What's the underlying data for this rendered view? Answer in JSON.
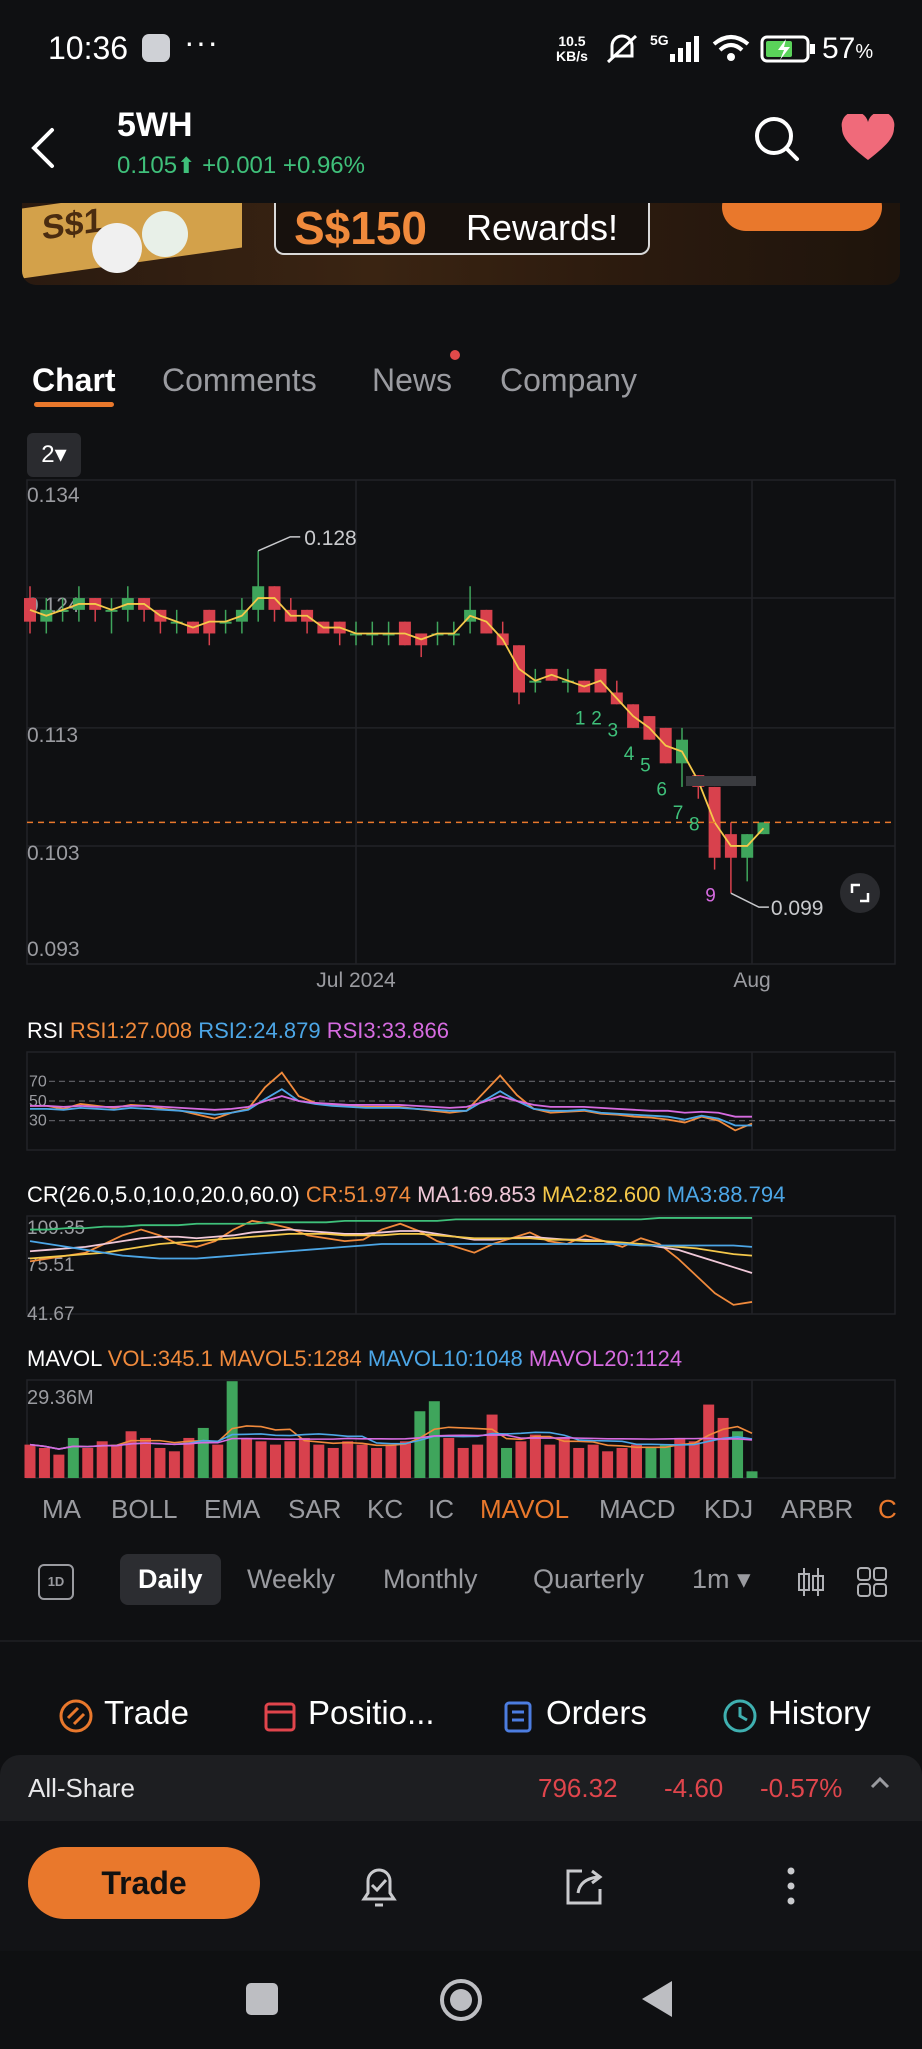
{
  "status_bar": {
    "time": "10:36",
    "menu_dots": "···",
    "net_speed": "10.5",
    "net_unit": "KB/s",
    "signal": "5G",
    "battery": "57",
    "battery_unit": "%"
  },
  "header": {
    "symbol": "5WH",
    "price": "0.105",
    "change": "+0.001",
    "change_pct": "+0.96%"
  },
  "banner": {
    "amount": "S$150",
    "text": "Rewards!",
    "card_text": "S$1"
  },
  "tabs": [
    {
      "label": "Chart",
      "active": true
    },
    {
      "label": "Comments",
      "active": false
    },
    {
      "label": "News",
      "active": false
    },
    {
      "label": "Company",
      "active": false
    }
  ],
  "chart_period_selector": "2▾",
  "chart_data": [
    {
      "type": "candlestick",
      "title": "",
      "y_ticks": [
        "0.134",
        "0.124",
        "0.113",
        "0.103",
        "0.093"
      ],
      "ylim": [
        0.093,
        0.134
      ],
      "x_ticks": [
        "Jul 2024",
        "Aug"
      ],
      "high_label": "0.128",
      "low_label": "0.099",
      "last_price_line": 0.105,
      "sequence_labels": [
        "1",
        "2",
        "3",
        "4",
        "5",
        "6",
        "7",
        "8",
        "9"
      ],
      "candles": [
        {
          "o": 0.124,
          "c": 0.122,
          "h": 0.125,
          "l": 0.121
        },
        {
          "o": 0.122,
          "c": 0.123,
          "h": 0.124,
          "l": 0.121
        },
        {
          "o": 0.123,
          "c": 0.123,
          "h": 0.124,
          "l": 0.122
        },
        {
          "o": 0.123,
          "c": 0.124,
          "h": 0.125,
          "l": 0.122
        },
        {
          "o": 0.124,
          "c": 0.123,
          "h": 0.124,
          "l": 0.122
        },
        {
          "o": 0.123,
          "c": 0.123,
          "h": 0.124,
          "l": 0.121
        },
        {
          "o": 0.123,
          "c": 0.124,
          "h": 0.125,
          "l": 0.122
        },
        {
          "o": 0.124,
          "c": 0.123,
          "h": 0.124,
          "l": 0.122
        },
        {
          "o": 0.123,
          "c": 0.122,
          "h": 0.123,
          "l": 0.121
        },
        {
          "o": 0.122,
          "c": 0.122,
          "h": 0.123,
          "l": 0.121
        },
        {
          "o": 0.122,
          "c": 0.121,
          "h": 0.122,
          "l": 0.121
        },
        {
          "o": 0.123,
          "c": 0.121,
          "h": 0.123,
          "l": 0.12
        },
        {
          "o": 0.122,
          "c": 0.122,
          "h": 0.123,
          "l": 0.121
        },
        {
          "o": 0.122,
          "c": 0.123,
          "h": 0.124,
          "l": 0.121
        },
        {
          "o": 0.123,
          "c": 0.125,
          "h": 0.128,
          "l": 0.122
        },
        {
          "o": 0.125,
          "c": 0.123,
          "h": 0.125,
          "l": 0.122
        },
        {
          "o": 0.123,
          "c": 0.122,
          "h": 0.124,
          "l": 0.122
        },
        {
          "o": 0.123,
          "c": 0.122,
          "h": 0.123,
          "l": 0.121
        },
        {
          "o": 0.122,
          "c": 0.121,
          "h": 0.122,
          "l": 0.121
        },
        {
          "o": 0.122,
          "c": 0.121,
          "h": 0.122,
          "l": 0.12
        },
        {
          "o": 0.121,
          "c": 0.121,
          "h": 0.122,
          "l": 0.12
        },
        {
          "o": 0.121,
          "c": 0.121,
          "h": 0.122,
          "l": 0.12
        },
        {
          "o": 0.121,
          "c": 0.121,
          "h": 0.122,
          "l": 0.12
        },
        {
          "o": 0.122,
          "c": 0.12,
          "h": 0.122,
          "l": 0.12
        },
        {
          "o": 0.121,
          "c": 0.12,
          "h": 0.121,
          "l": 0.119
        },
        {
          "o": 0.121,
          "c": 0.121,
          "h": 0.122,
          "l": 0.12
        },
        {
          "o": 0.121,
          "c": 0.121,
          "h": 0.122,
          "l": 0.12
        },
        {
          "o": 0.122,
          "c": 0.123,
          "h": 0.125,
          "l": 0.121
        },
        {
          "o": 0.123,
          "c": 0.121,
          "h": 0.123,
          "l": 0.121
        },
        {
          "o": 0.121,
          "c": 0.12,
          "h": 0.122,
          "l": 0.12
        },
        {
          "o": 0.12,
          "c": 0.116,
          "h": 0.12,
          "l": 0.115
        },
        {
          "o": 0.117,
          "c": 0.117,
          "h": 0.118,
          "l": 0.116
        },
        {
          "o": 0.118,
          "c": 0.117,
          "h": 0.118,
          "l": 0.117
        },
        {
          "o": 0.117,
          "c": 0.117,
          "h": 0.118,
          "l": 0.116
        },
        {
          "o": 0.117,
          "c": 0.116,
          "h": 0.117,
          "l": 0.116
        },
        {
          "o": 0.118,
          "c": 0.116,
          "h": 0.118,
          "l": 0.116
        },
        {
          "o": 0.116,
          "c": 0.115,
          "h": 0.117,
          "l": 0.115
        },
        {
          "o": 0.115,
          "c": 0.113,
          "h": 0.115,
          "l": 0.113
        },
        {
          "o": 0.114,
          "c": 0.112,
          "h": 0.114,
          "l": 0.112
        },
        {
          "o": 0.113,
          "c": 0.11,
          "h": 0.113,
          "l": 0.11
        },
        {
          "o": 0.11,
          "c": 0.112,
          "h": 0.113,
          "l": 0.108
        },
        {
          "o": 0.109,
          "c": 0.108,
          "h": 0.109,
          "l": 0.107
        },
        {
          "o": 0.108,
          "c": 0.102,
          "h": 0.108,
          "l": 0.101
        },
        {
          "o": 0.104,
          "c": 0.102,
          "h": 0.105,
          "l": 0.099
        },
        {
          "o": 0.102,
          "c": 0.104,
          "h": 0.104,
          "l": 0.1
        },
        {
          "o": 0.104,
          "c": 0.105,
          "h": 0.105,
          "l": 0.104
        }
      ]
    },
    {
      "type": "line",
      "title": "RSI",
      "y_ticks": [
        "70",
        "50",
        "30"
      ],
      "ylim": [
        0,
        100
      ],
      "series": [
        {
          "name": "RSI1:27.008",
          "color": "#f08a3c",
          "values": [
            45,
            45,
            42,
            47,
            45,
            43,
            46,
            45,
            42,
            40,
            36,
            32,
            38,
            42,
            64,
            79,
            55,
            48,
            46,
            45,
            44,
            44,
            44,
            42,
            40,
            38,
            40,
            58,
            76,
            56,
            42,
            38,
            39,
            40,
            37,
            36,
            34,
            33,
            31,
            28,
            34,
            30,
            20,
            27
          ]
        },
        {
          "name": "RSI2:24.879",
          "color": "#4ca6e6",
          "values": [
            42,
            42,
            41,
            43,
            42,
            41,
            43,
            42,
            41,
            40,
            38,
            36,
            38,
            41,
            52,
            62,
            50,
            47,
            45,
            44,
            43,
            43,
            43,
            42,
            41,
            40,
            40,
            50,
            60,
            50,
            42,
            40,
            40,
            41,
            38,
            37,
            36,
            35,
            34,
            31,
            35,
            32,
            25,
            25
          ]
        },
        {
          "name": "RSI3:33.866",
          "color": "#d66be0",
          "values": [
            45,
            45,
            44,
            45,
            44,
            44,
            45,
            45,
            44,
            43,
            42,
            41,
            42,
            44,
            50,
            55,
            50,
            48,
            47,
            46,
            46,
            46,
            46,
            45,
            44,
            43,
            44,
            49,
            55,
            50,
            46,
            44,
            44,
            44,
            43,
            42,
            41,
            40,
            40,
            38,
            39,
            38,
            34,
            34
          ]
        }
      ]
    },
    {
      "type": "line",
      "title": "CR(26.0,5.0,10.0,20.0,60.0)",
      "y_ticks": [
        "109.35",
        "75.51",
        "41.67"
      ],
      "ylim": [
        41.67,
        109.35
      ],
      "series": [
        {
          "name": "CR:51.974",
          "color": "#f08a3c",
          "values": [
            78,
            80,
            82,
            84,
            90,
            96,
            100,
            96,
            90,
            88,
            92,
            100,
            106,
            104,
            101,
            96,
            94,
            92,
            93,
            100,
            104,
            99,
            92,
            88,
            84,
            90,
            94,
            98,
            92,
            90,
            96,
            92,
            88,
            94,
            90,
            80,
            68,
            56,
            48,
            50
          ]
        },
        {
          "name": "MA1:69.853",
          "color": "#f0c8d8",
          "values": [
            85,
            86,
            87,
            88,
            90,
            92,
            94,
            95,
            95,
            94,
            95,
            96,
            98,
            99,
            100,
            99,
            98,
            97,
            97,
            98,
            99,
            99,
            97,
            95,
            93,
            93,
            94,
            95,
            94,
            93,
            93,
            92,
            90,
            90,
            88,
            86,
            82,
            78,
            74,
            70
          ]
        },
        {
          "name": "MA2:82.600",
          "color": "#f5c84a",
          "values": [
            80,
            81,
            82,
            83,
            84,
            86,
            88,
            90,
            91,
            92,
            93,
            94,
            95,
            96,
            97,
            97,
            97,
            96,
            96,
            96,
            97,
            97,
            96,
            95,
            94,
            94,
            94,
            94,
            93,
            93,
            92,
            92,
            91,
            90,
            89,
            88,
            87,
            85,
            83,
            82
          ]
        },
        {
          "name": "MA3:88.794",
          "color": "#4ca6e6",
          "values": [
            92,
            90,
            88,
            86,
            84,
            82,
            81,
            80,
            80,
            80,
            81,
            82,
            83,
            84,
            85,
            86,
            87,
            88,
            89,
            90,
            90,
            90,
            90,
            90,
            90,
            90,
            90,
            90,
            90,
            90,
            90,
            90,
            90,
            89,
            89,
            89,
            89,
            89,
            89,
            88
          ]
        },
        {
          "name": "",
          "color": "#3fc07a",
          "values": [
            100,
            100,
            101,
            101,
            102,
            102,
            103,
            103,
            103,
            104,
            104,
            104,
            104,
            105,
            105,
            105,
            105,
            106,
            106,
            106,
            106,
            106,
            106,
            107,
            107,
            107,
            107,
            107,
            107,
            107,
            107,
            107,
            107,
            107,
            108,
            108,
            108,
            108,
            108,
            108
          ]
        }
      ]
    },
    {
      "type": "bar",
      "title": "MAVOL",
      "y_ticks": [
        "29.36M"
      ],
      "ylim": [
        0,
        29.36
      ],
      "legend": [
        "VOL:345.1",
        "MAVOL5:1284",
        "MAVOL10:1048",
        "MAVOL20:1124"
      ],
      "series_colors": {
        "VOL": "#f08a3c",
        "MAVOL5": "#f08a3c",
        "MAVOL10": "#4ca6e6",
        "MAVOL20": "#d66be0"
      },
      "bars": [
        {
          "v": 10,
          "up": false
        },
        {
          "v": 9,
          "up": false
        },
        {
          "v": 7,
          "up": false
        },
        {
          "v": 12,
          "up": true
        },
        {
          "v": 9,
          "up": false
        },
        {
          "v": 11,
          "up": false
        },
        {
          "v": 10,
          "up": false
        },
        {
          "v": 14,
          "up": false
        },
        {
          "v": 12,
          "up": false
        },
        {
          "v": 9,
          "up": false
        },
        {
          "v": 8,
          "up": false
        },
        {
          "v": 12,
          "up": false
        },
        {
          "v": 15,
          "up": true
        },
        {
          "v": 10,
          "up": false
        },
        {
          "v": 29,
          "up": true
        },
        {
          "v": 12,
          "up": false
        },
        {
          "v": 11,
          "up": false
        },
        {
          "v": 10,
          "up": false
        },
        {
          "v": 11,
          "up": false
        },
        {
          "v": 12,
          "up": false
        },
        {
          "v": 10,
          "up": false
        },
        {
          "v": 9,
          "up": false
        },
        {
          "v": 11,
          "up": false
        },
        {
          "v": 10,
          "up": false
        },
        {
          "v": 9,
          "up": false
        },
        {
          "v": 10,
          "up": false
        },
        {
          "v": 11,
          "up": false
        },
        {
          "v": 20,
          "up": true
        },
        {
          "v": 23,
          "up": true
        },
        {
          "v": 12,
          "up": false
        },
        {
          "v": 9,
          "up": false
        },
        {
          "v": 10,
          "up": false
        },
        {
          "v": 19,
          "up": false
        },
        {
          "v": 9,
          "up": true
        },
        {
          "v": 11,
          "up": false
        },
        {
          "v": 13,
          "up": false
        },
        {
          "v": 10,
          "up": false
        },
        {
          "v": 12,
          "up": false
        },
        {
          "v": 9,
          "up": false
        },
        {
          "v": 10,
          "up": false
        },
        {
          "v": 8,
          "up": false
        },
        {
          "v": 9,
          "up": false
        },
        {
          "v": 10,
          "up": false
        },
        {
          "v": 9,
          "up": true
        },
        {
          "v": 10,
          "up": true
        },
        {
          "v": 12,
          "up": false
        },
        {
          "v": 11,
          "up": false
        },
        {
          "v": 22,
          "up": false
        },
        {
          "v": 18,
          "up": false
        },
        {
          "v": 14,
          "up": true
        },
        {
          "v": 2,
          "up": true
        }
      ]
    }
  ],
  "indicator_tabs": [
    "MA",
    "BOLL",
    "EMA",
    "SAR",
    "KC",
    "IC",
    "MAVOL",
    "MACD",
    "KDJ",
    "ARBR",
    "C"
  ],
  "indicator_tabs_active": "MAVOL",
  "period_tabs": {
    "icon_label": "1D",
    "items": [
      "Daily",
      "Weekly",
      "Monthly",
      "Quarterly",
      "1m ▾"
    ],
    "active": "Daily"
  },
  "actions": [
    {
      "label": "Trade",
      "icon": "trade-icon",
      "color": "#e9782c"
    },
    {
      "label": "Positio...",
      "icon": "position-icon",
      "color": "#e0454c"
    },
    {
      "label": "Orders",
      "icon": "orders-icon",
      "color": "#4c7de0"
    },
    {
      "label": "History",
      "icon": "history-icon",
      "color": "#3fb0b0"
    }
  ],
  "index_bar": {
    "name": "All-Share",
    "value": "796.32",
    "change": "-4.60",
    "change_pct": "-0.57%"
  },
  "bottom_bar": {
    "trade_label": "Trade"
  },
  "colors": {
    "up": "#3fa55c",
    "down": "#d8414d",
    "accent": "#e9782c",
    "bg": "#0f1012"
  }
}
